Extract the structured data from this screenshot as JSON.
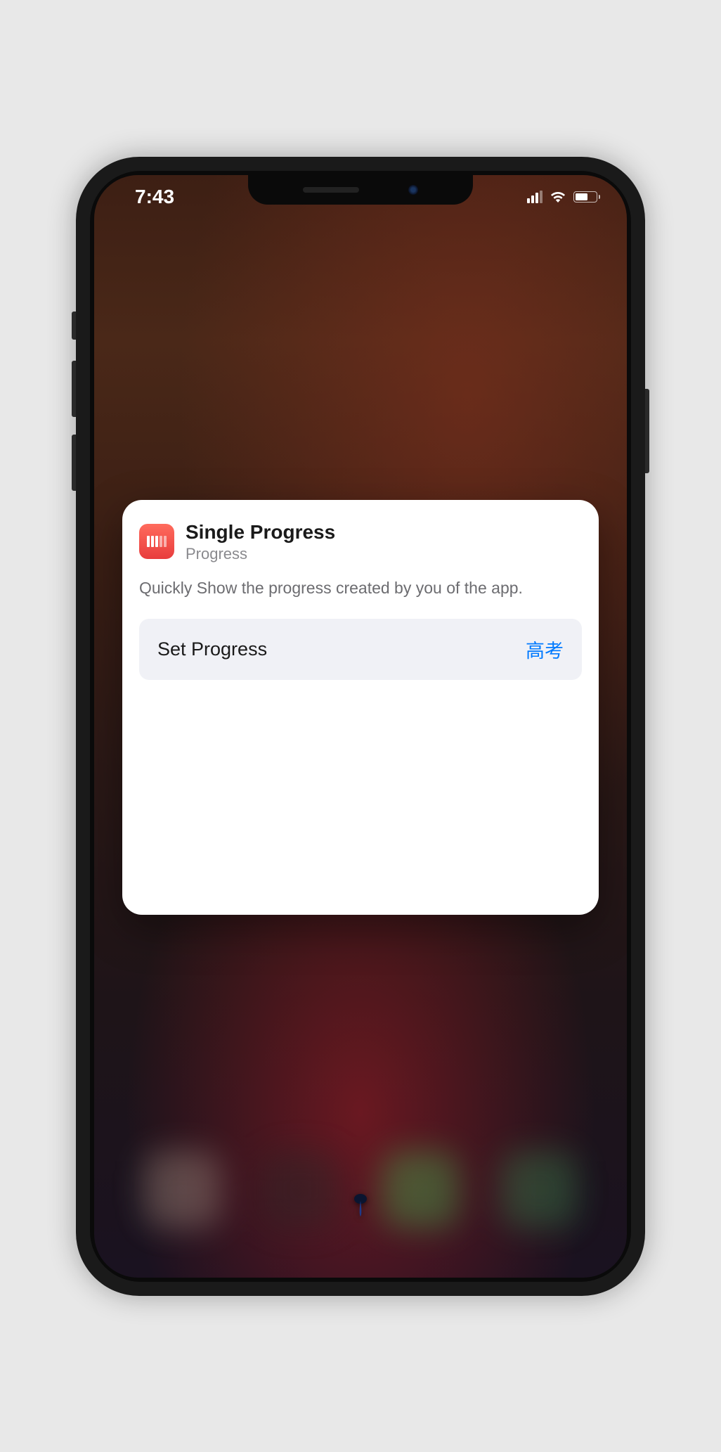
{
  "status": {
    "time": "7:43"
  },
  "widget": {
    "title": "Single Progress",
    "subtitle": "Progress",
    "description": "Quickly Show the progress created by you of the app.",
    "row": {
      "label": "Set Progress",
      "value": "高考"
    }
  },
  "colors": {
    "accent": "#007aff",
    "app_icon_gradient_top": "#ff6b5d",
    "app_icon_gradient_bottom": "#e83d3d"
  }
}
